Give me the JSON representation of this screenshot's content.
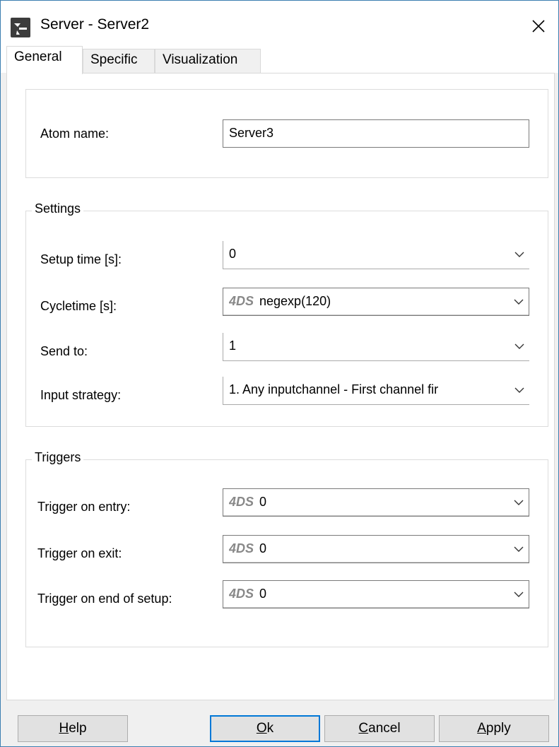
{
  "window": {
    "title": "Server - Server2"
  },
  "tabs": [
    {
      "label": "General",
      "active": true
    },
    {
      "label": "Specific",
      "active": false
    },
    {
      "label": "Visualization",
      "active": false
    }
  ],
  "atom": {
    "label": "Atom name:",
    "value": "Server3"
  },
  "settings": {
    "title": "Settings",
    "setup_time": {
      "label": "Setup time [s]:",
      "value": "0"
    },
    "cycletime": {
      "label": "Cycletime [s]:",
      "prefix": "4DS",
      "value": "negexp(120)"
    },
    "send_to": {
      "label": "Send to:",
      "value": "1"
    },
    "input_strategy": {
      "label": "Input strategy:",
      "value": "1. Any inputchannel -  First channel fir"
    }
  },
  "triggers": {
    "title": "Triggers",
    "on_entry": {
      "label": "Trigger on entry:",
      "prefix": "4DS",
      "value": "0"
    },
    "on_exit": {
      "label": "Trigger on exit:",
      "prefix": "4DS",
      "value": "0"
    },
    "on_end_setup": {
      "label": "Trigger on end of setup:",
      "prefix": "4DS",
      "value": "0"
    }
  },
  "buttons": {
    "help": {
      "mnemonic": "H",
      "rest": "elp"
    },
    "ok": {
      "mnemonic": "O",
      "rest": "k"
    },
    "cancel": {
      "mnemonic": "C",
      "rest": "ancel"
    },
    "apply": {
      "mnemonic": "A",
      "rest": "pply"
    }
  },
  "colors": {
    "accent": "#0078d7",
    "window_border": "#3c7fb1",
    "prefix_gray": "#888888"
  },
  "icons": {
    "app": "server-app-icon",
    "close": "close-icon",
    "dropdown": "chevron-down-icon"
  }
}
